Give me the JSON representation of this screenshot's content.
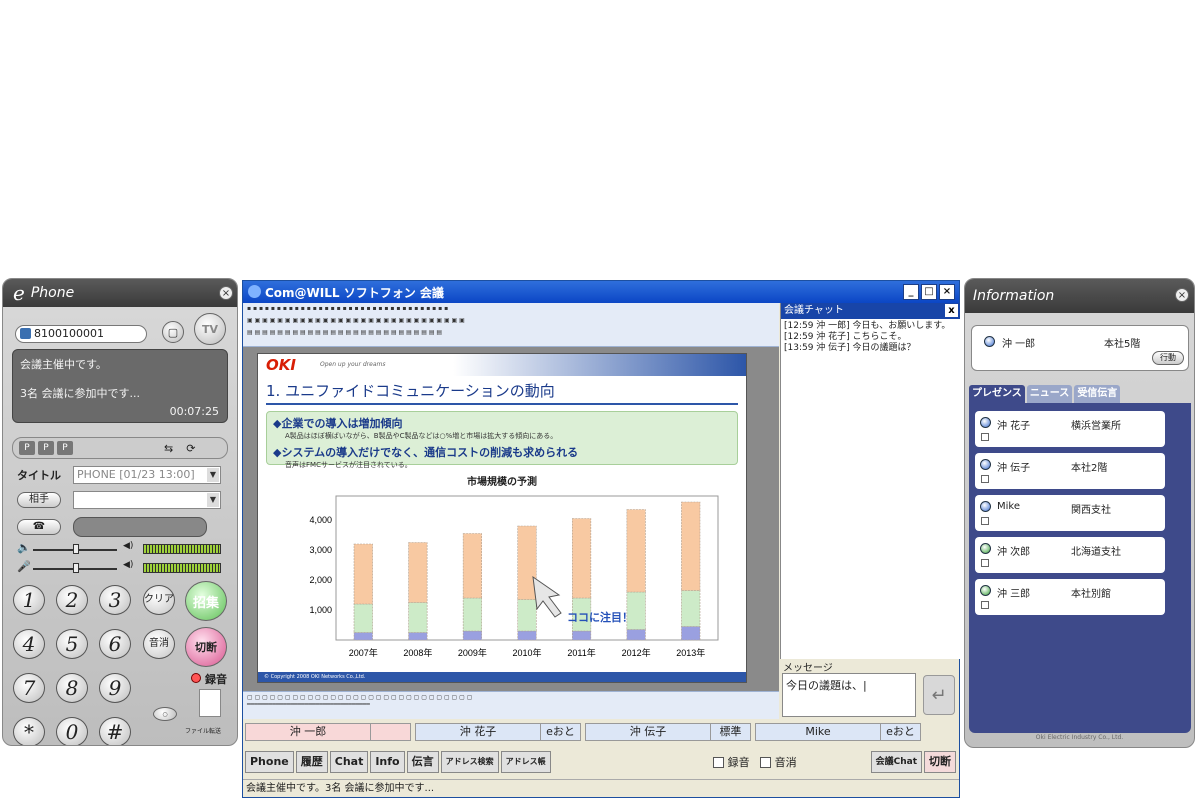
{
  "phone": {
    "title": "Phone",
    "logo": "e",
    "number": "8100100001",
    "tv_label": "TV",
    "status_line1": "会議主催中です。",
    "status_line2": "3名 会議に参加中です...",
    "timer": "00:07:25",
    "title_label": "タイトル",
    "title_value": "PHONE [01/23 13:00]",
    "partner_label": "相手",
    "keys": [
      "1",
      "2",
      "3",
      "4",
      "5",
      "6",
      "7",
      "8",
      "9",
      "*",
      "0",
      "#"
    ],
    "clear_label": "クリア",
    "call_label": "招集",
    "mute_label": "音消",
    "hangup_label": "切断",
    "record_label": "録音",
    "transfer_label": "ファイル転送"
  },
  "conference": {
    "title": "Com@WILL ソフトフォン 会議",
    "slide": {
      "brand": "OKI",
      "brand_tag": "Open up your dreams",
      "title": "1. ユニファイドコミュニケーションの動向",
      "bullet1": "◆企業での導入は増加傾向",
      "sub1": "A製品はほぼ横ばいながら、B製品やC製品などは○%増と市場は拡大する傾向にある。",
      "bullet2": "◆システムの導入だけでなく、通信コストの削減も求められる",
      "sub2": "音声はFMCサービスが注目されている。",
      "chart_title": "市場規模の予測",
      "annotation": "ココに注目！",
      "footer": "© Copyright 2008 OKI Networks Co.,Ltd."
    },
    "chat": {
      "title": "会議チャット",
      "lines": [
        "[12:59 沖 一郎]  今日も、お願いします。",
        "[12:59 沖 花子]  こちらこそ。",
        "[13:59 沖 伝子]  今日の議題は？"
      ],
      "message_label": "メッセージ",
      "message_value": "今日の議題は、|"
    },
    "participants": [
      {
        "name": "沖 一郎",
        "status": ""
      },
      {
        "name": "沖 花子",
        "status": "eおと"
      },
      {
        "name": "沖 伝子",
        "status": "標準"
      },
      {
        "name": "Mike",
        "status": "eおと"
      }
    ],
    "tabs": [
      "Phone",
      "履歴",
      "Chat",
      "Info",
      "伝言",
      "アドレス検索",
      "アドレス帳"
    ],
    "record_check": "録音",
    "mute_check": "音消",
    "chat_button": "会議Chat",
    "hangup_button": "切断",
    "status": "会議主催中です。3名 会議に参加中です..."
  },
  "info": {
    "title": "Information",
    "self_name": "沖 一郎",
    "self_location": "本社5階",
    "action_label": "行動",
    "tabs": [
      "プレゼンス",
      "ニュース",
      "受信伝言"
    ],
    "contacts": [
      {
        "name": "沖 花子",
        "location": "横浜営業所",
        "icon": "blue"
      },
      {
        "name": "沖 伝子",
        "location": "本社2階",
        "icon": "blue"
      },
      {
        "name": "Mike",
        "location": "関西支社",
        "icon": "blue"
      },
      {
        "name": "沖 次郎",
        "location": "北海道支社",
        "icon": "green"
      },
      {
        "name": "沖 三郎",
        "location": "本社別館",
        "icon": "green"
      }
    ],
    "copyright": "Oki Electric Industry Co., Ltd."
  },
  "chart_data": {
    "type": "bar",
    "title": "市場規模の予測",
    "categories": [
      "2007年",
      "2008年",
      "2009年",
      "2010年",
      "2011年",
      "2012年",
      "2013年"
    ],
    "series": [
      {
        "values": [
          250,
          250,
          300,
          300,
          300,
          350,
          450
        ],
        "color": "#9aa0e0"
      },
      {
        "values": [
          950,
          1000,
          1100,
          1050,
          1100,
          1250,
          1200
        ],
        "color": "#cdebc8"
      },
      {
        "values": [
          2000,
          2000,
          2150,
          2450,
          2650,
          2750,
          2950
        ],
        "color": "#f8c9a2"
      }
    ],
    "yticks": [
      "1,000",
      "2,000",
      "3,000",
      "4,000"
    ],
    "ylim": [
      0,
      4800
    ]
  }
}
